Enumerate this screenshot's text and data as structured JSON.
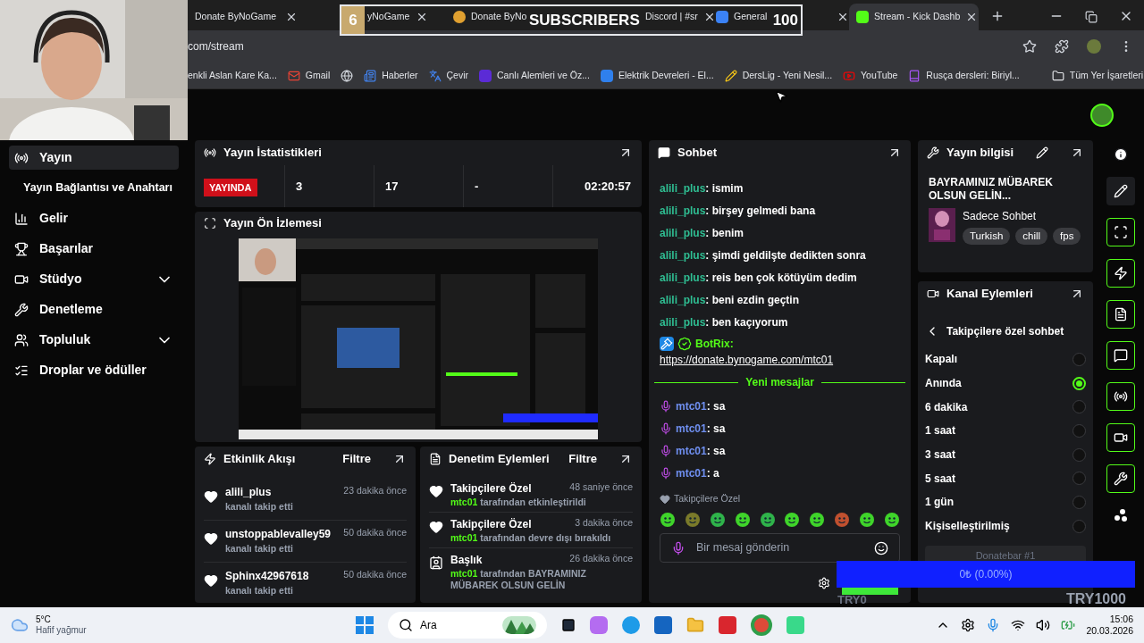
{
  "overlay_goal": {
    "count": "6",
    "label": "SUBSCRIBERS",
    "goal": "100"
  },
  "browser": {
    "tabs": [
      {
        "label": "Donate ByNoGame",
        "kind": "none",
        "selected": false
      },
      {
        "label": "yNoGame",
        "kind": "none",
        "selected": false
      },
      {
        "label": "Donate ByNo",
        "kind": "coin",
        "selected": false
      },
      {
        "label": "Discord | #sr",
        "kind": "none",
        "selected": false
      },
      {
        "label": "General",
        "kind": "g",
        "selected": false
      },
      {
        "label": "Stream - Kick Dashb",
        "kind": "kick",
        "selected": true
      }
    ],
    "url": "com/stream",
    "bookmarks": [
      {
        "label": "enkli Aslan Kare Ka...",
        "kind": "none"
      },
      {
        "label": "Gmail",
        "kind": "mail"
      },
      {
        "kind": "globe"
      },
      {
        "label": "Haberler",
        "kind": "news"
      },
      {
        "label": "Çevir",
        "kind": "translate"
      },
      {
        "label": "Canlı Alemleri ve Öz...",
        "kind": "bp"
      },
      {
        "label": "Elektrik Devreleri - El...",
        "kind": "doc"
      },
      {
        "label": "DersLig - Yeni Nesil...",
        "kind": "pencil"
      },
      {
        "label": "YouTube",
        "kind": "video"
      },
      {
        "label": "Rusça dersleri: Biriyl...",
        "kind": "book"
      }
    ],
    "all_bookmarks": "Tüm Yer İşaretleri"
  },
  "sidebar": {
    "items": [
      {
        "label": "Yayın",
        "kind": "link",
        "selected": true
      },
      {
        "label": "Yayın Bağlantısı ve Anahtarı",
        "kind": "sub",
        "selected": false
      },
      {
        "label": "Gelir",
        "kind": "link",
        "selected": false
      },
      {
        "label": "Başarılar",
        "kind": "link",
        "selected": false
      },
      {
        "label": "Stüdyo",
        "kind": "group",
        "expanded": false,
        "selected": false
      },
      {
        "label": "Denetleme",
        "kind": "link",
        "selected": false
      },
      {
        "label": "Topluluk",
        "kind": "group",
        "expanded": false,
        "selected": false
      },
      {
        "label": "Droplar ve ödüller",
        "kind": "link",
        "selected": false
      }
    ]
  },
  "stats": {
    "title": "Yayın İstatistikleri",
    "status": "YAYINDA",
    "values": [
      "3",
      "17",
      "-",
      "02:20:57"
    ]
  },
  "preview": {
    "title": "Yayın Ön İzlemesi"
  },
  "activity": {
    "title": "Etkinlik Akışı",
    "filter": "Filtre",
    "rows": [
      {
        "name": "alili_plus",
        "time": "23 dakika önce",
        "text": "kanalı takip etti"
      },
      {
        "name": "unstoppablevalley59",
        "time": "50 dakika önce",
        "text": "kanalı takip etti"
      },
      {
        "name": "Sphinx42967618",
        "time": "50 dakika önce",
        "text": "kanalı takip etti"
      }
    ]
  },
  "moderation": {
    "title": "Denetim Eylemleri",
    "filter": "Filtre",
    "rows": [
      {
        "kind": "follow",
        "name": "Takipçilere Özel",
        "time": "48 saniye önce",
        "actor": "mtc01",
        "text": "tarafından etkinleştirildi"
      },
      {
        "kind": "follow",
        "name": "Takipçilere Özel",
        "time": "3 dakika önce",
        "actor": "mtc01",
        "text": "tarafından devre dışı bırakıldı"
      },
      {
        "kind": "title",
        "name": "Başlık",
        "time": "26 dakika önce",
        "actor": "mtc01",
        "text": "tarafından **BAYRAMINIZ MÜBAREK OLSUN GELİN**"
      }
    ]
  },
  "chat": {
    "title": "Sohbet",
    "messages": [
      {
        "kind": "viewer",
        "user": "alili_plus",
        "color": "#2fbf93",
        "text": ": ismim"
      },
      {
        "kind": "viewer",
        "user": "alili_plus",
        "color": "#2fbf93",
        "text": ": birşey gelmedi bana"
      },
      {
        "kind": "viewer",
        "user": "alili_plus",
        "color": "#2fbf93",
        "text": ": benim"
      },
      {
        "kind": "viewer",
        "user": "alili_plus",
        "color": "#2fbf93",
        "text": ": şimdi geldilşte dedikten sonra"
      },
      {
        "kind": "viewer",
        "user": "alili_plus",
        "color": "#2fbf93",
        "text": ": reis ben çok kötüyüm dedim"
      },
      {
        "kind": "viewer",
        "user": "alili_plus",
        "color": "#2fbf93",
        "text": ": beni ezdin geçtin"
      },
      {
        "kind": "viewer",
        "user": "alili_plus",
        "color": "#2fbf93",
        "text": ": ben kaçıyorum"
      },
      {
        "kind": "bot",
        "user": "BotRix:",
        "color": "#53fc18",
        "text": "https://donate.bynogame.com/mtc01"
      },
      {
        "kind": "divider",
        "text": "Yeni mesajlar"
      },
      {
        "kind": "broadcaster",
        "user": "mtc01",
        "color": "#6f8ff0",
        "text": ": sa"
      },
      {
        "kind": "broadcaster",
        "user": "mtc01",
        "color": "#6f8ff0",
        "text": ": sa"
      },
      {
        "kind": "broadcaster",
        "user": "mtc01",
        "color": "#6f8ff0",
        "text": ": sa"
      },
      {
        "kind": "broadcaster",
        "user": "mtc01",
        "color": "#6f8ff0",
        "text": ": a"
      }
    ],
    "mode": "Takipçilere Özel",
    "placeholder": "Bir mesaj gönderin"
  },
  "stream_info": {
    "title": "Yayın bilgisi",
    "stream_title": "BAYRAMINIZ MÜBAREK OLSUN GELİN...",
    "category": "Sadece Sohbet",
    "tags": [
      "Turkish",
      "chill",
      "fps"
    ]
  },
  "channel_actions": {
    "title": "Kanal Eylemleri",
    "back": "Takipçilere özel sohbet",
    "options": [
      {
        "label": "Kapalı",
        "selected": false
      },
      {
        "label": "Anında",
        "selected": true
      },
      {
        "label": "6 dakika",
        "selected": false
      },
      {
        "label": "1 saat",
        "selected": false
      },
      {
        "label": "3 saat",
        "selected": false
      },
      {
        "label": "5 saat",
        "selected": false
      },
      {
        "label": "1 gün",
        "selected": false
      },
      {
        "label": "Kişiselleştirilmiş",
        "selected": false
      }
    ]
  },
  "donation_overlay": {
    "label": "Donatebar #1",
    "amount": "0₺ (0.00%)",
    "min": "TRY0",
    "max": "TRY1000"
  },
  "taskbar": {
    "temperature": "5°C",
    "weather": "Hafif yağmur",
    "search": "Ara",
    "time": "15:06",
    "date": "20.03.2026"
  }
}
